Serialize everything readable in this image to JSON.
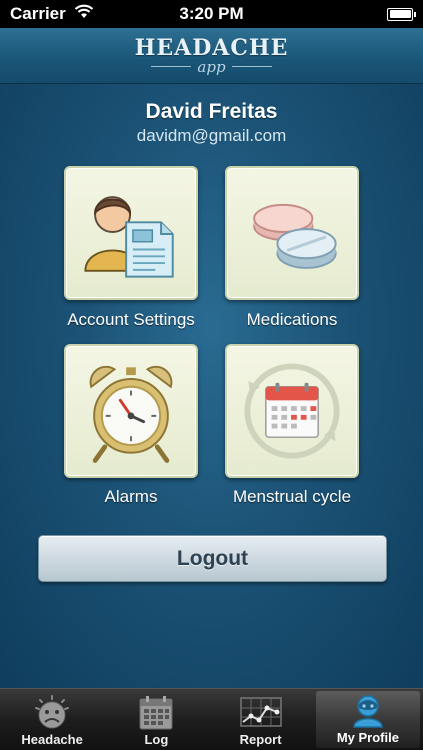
{
  "status_bar": {
    "carrier": "Carrier",
    "time": "3:20 PM"
  },
  "header": {
    "logo_main": "HEADACHE",
    "logo_sub": "app"
  },
  "profile": {
    "name": "David Freitas",
    "email": "davidm@gmail.com"
  },
  "tiles": [
    {
      "label": "Account Settings",
      "icon": "account-settings-icon"
    },
    {
      "label": "Medications",
      "icon": "pills-icon"
    },
    {
      "label": "Alarms",
      "icon": "alarm-clock-icon"
    },
    {
      "label": "Menstrual cycle",
      "icon": "calendar-cycle-icon"
    }
  ],
  "logout_label": "Logout",
  "tab_bar": {
    "tabs": [
      {
        "label": "Headache",
        "icon": "sad-face-icon",
        "active": false
      },
      {
        "label": "Log",
        "icon": "calendar-icon",
        "active": false
      },
      {
        "label": "Report",
        "icon": "chart-icon",
        "active": false
      },
      {
        "label": "My Profile",
        "icon": "user-icon",
        "active": true
      }
    ]
  },
  "colors": {
    "background": "#1b5275",
    "tile_background": "#eef2dc",
    "tab_bar": "#1e1e1e"
  }
}
